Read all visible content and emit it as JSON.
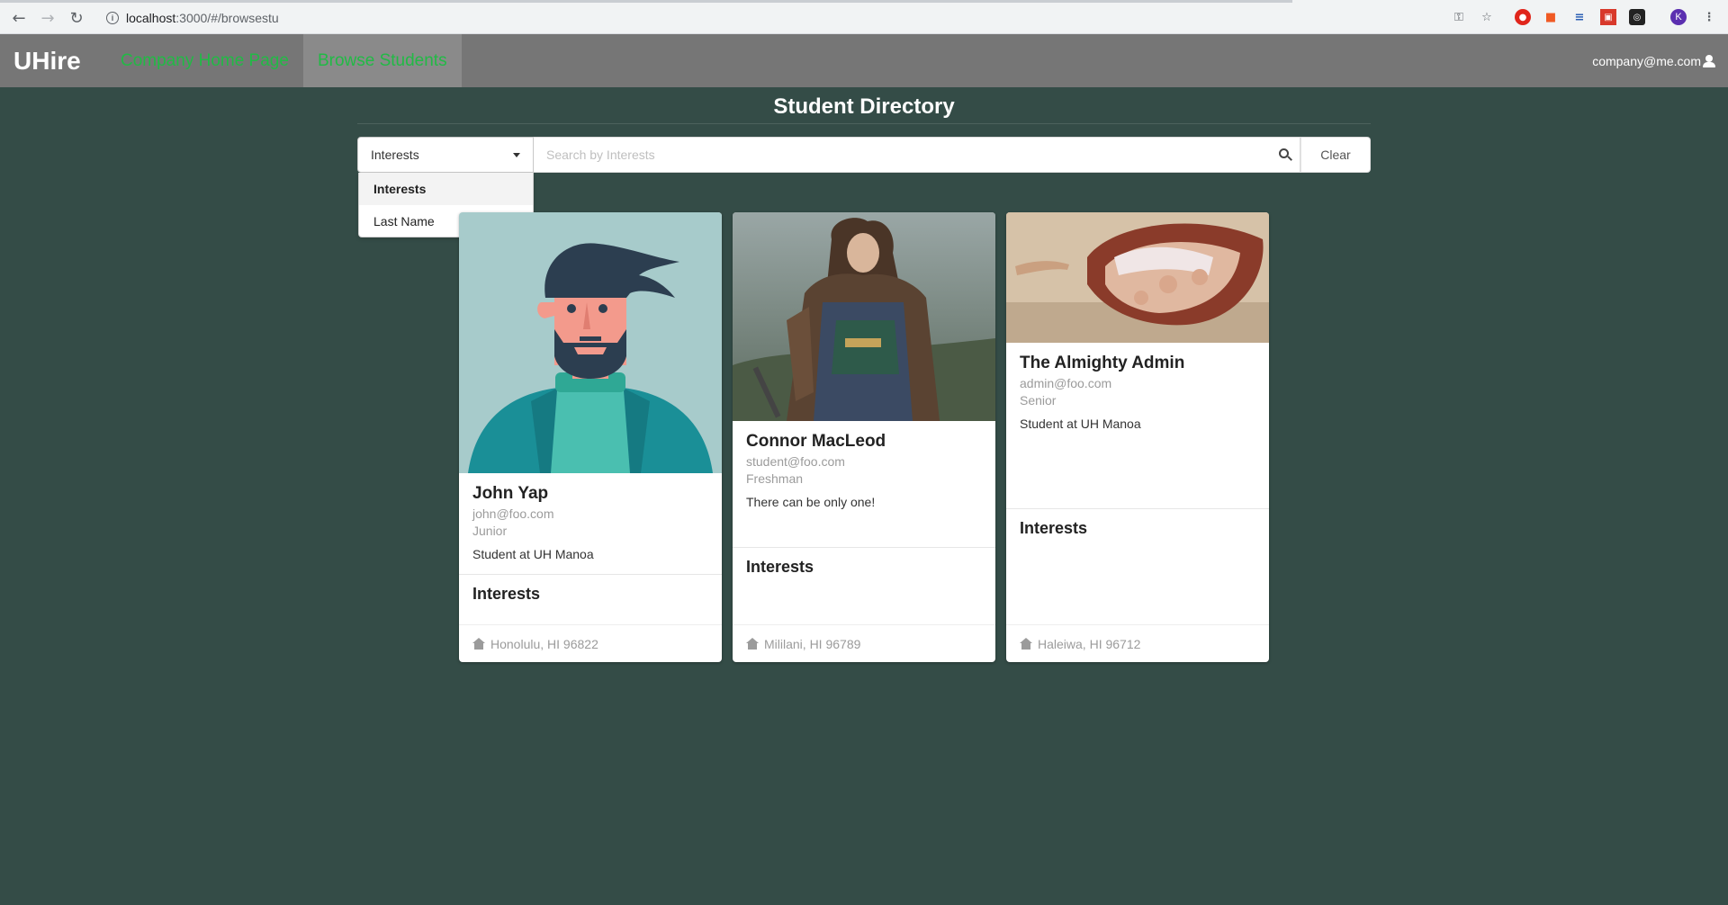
{
  "browser": {
    "url_host": "localhost",
    "url_rest": ":3000/#/browsestu"
  },
  "navbar": {
    "brand": "UHire",
    "links": [
      "Company Home Page",
      "Browse Students"
    ],
    "user": "company@me.com"
  },
  "page": {
    "title": "Student Directory"
  },
  "search": {
    "filter_value": "Interests",
    "placeholder": "Search by Interests",
    "clear_label": "Clear",
    "options": [
      "Interests",
      "Last Name"
    ]
  },
  "cards": [
    {
      "name": "John Yap",
      "email": "john@foo.com",
      "year": "Junior",
      "description": "Student at UH Manoa",
      "interests_heading": "Interests",
      "location": "Honolulu, HI 96822"
    },
    {
      "name": "Connor MacLeod",
      "email": "student@foo.com",
      "year": "Freshman",
      "description": "There can be only one!",
      "interests_heading": "Interests",
      "location": "Mililani, HI 96789"
    },
    {
      "name": "The Almighty Admin",
      "email": "admin@foo.com",
      "year": "Senior",
      "description": "Student at UH Manoa",
      "interests_heading": "Interests",
      "location": "Haleiwa, HI 96712"
    }
  ],
  "colors": {
    "page_bg": "#344c47",
    "navbar_bg": "#767676",
    "link_green": "#21ba45"
  }
}
